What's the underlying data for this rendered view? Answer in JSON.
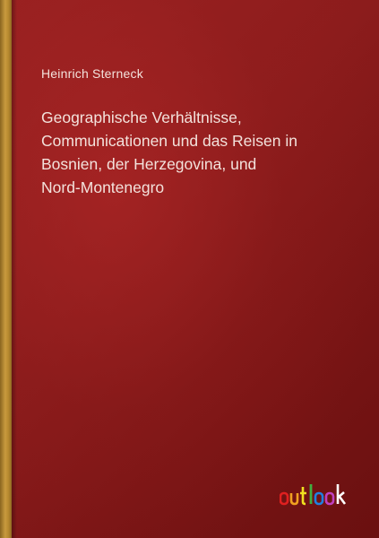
{
  "book": {
    "author": "Heinrich Sterneck",
    "title_lines": [
      "Geographische Verhältnisse,",
      "Communicationen und das Reisen in",
      "Bosnien, der Herzegovina, und",
      "Nord-Montenegro"
    ]
  },
  "publisher": {
    "logo_text": "outlook",
    "logo_icon": "outlook-logo-icon",
    "letter_colors": [
      "#e02020",
      "#f0a020",
      "#f0e020",
      "#40b040",
      "#2080e0",
      "#c040c0",
      "#ffffff"
    ]
  },
  "colors": {
    "cover_background": "#8c1c1c",
    "spine": "#c99a3e",
    "text": "#f3e2dc"
  }
}
